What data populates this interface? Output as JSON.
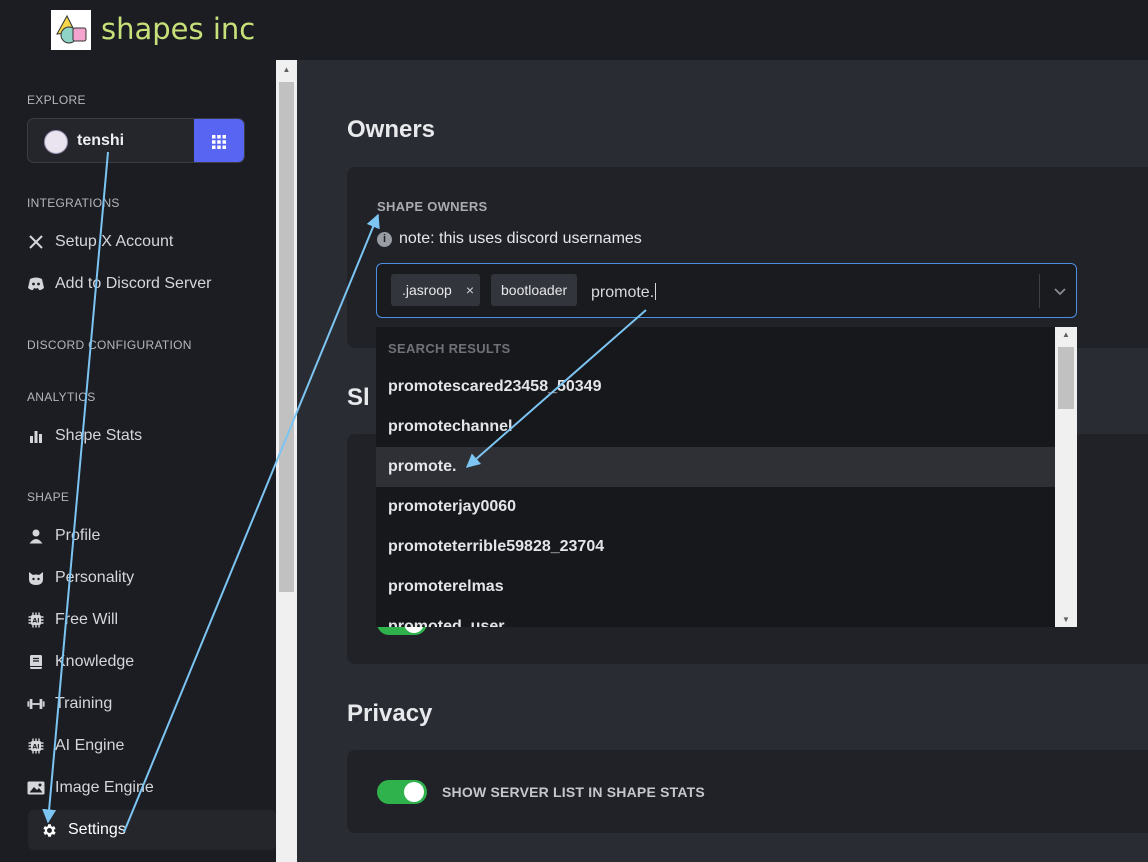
{
  "app": {
    "title": "shapes inc"
  },
  "sidebar": {
    "explore_label": "EXPLORE",
    "shape_selector": {
      "name": "tenshi"
    },
    "integrations_label": "INTEGRATIONS",
    "integrations": [
      {
        "label": "Setup X Account",
        "icon": "x-logo-icon"
      },
      {
        "label": "Add to Discord Server",
        "icon": "discord-icon"
      }
    ],
    "discord_config_label": "DISCORD CONFIGURATION",
    "analytics_label": "ANALYTICS",
    "analytics": [
      {
        "label": "Shape Stats",
        "icon": "bar-chart-icon"
      }
    ],
    "shape_label": "SHAPE",
    "shape_items": [
      {
        "label": "Profile",
        "icon": "user-icon"
      },
      {
        "label": "Personality",
        "icon": "cat-face-icon"
      },
      {
        "label": "Free Will",
        "icon": "chip-icon"
      },
      {
        "label": "Knowledge",
        "icon": "book-icon"
      },
      {
        "label": "Training",
        "icon": "dumbbell-icon"
      },
      {
        "label": "AI Engine",
        "icon": "chip-icon"
      },
      {
        "label": "Image Engine",
        "icon": "image-icon"
      },
      {
        "label": "Settings",
        "icon": "gear-icon",
        "active": true
      }
    ]
  },
  "main": {
    "owners_heading": "Owners",
    "shape_owners_label": "SHAPE OWNERS",
    "note": "note: this uses discord usernames",
    "owner_tags": [
      ".jasroop",
      "bootloader"
    ],
    "owner_tag_remove": "×",
    "search_value": "promote.",
    "dropdown": {
      "header": "SEARCH RESULTS",
      "options": [
        "promotescared23458_50349",
        "promotechannel",
        "promote.",
        "promoterjay0060",
        "promoteterrible59828_23704",
        "promoterelmas",
        "promoted_user"
      ],
      "highlighted_index": 2
    },
    "slash_heading": "Sl",
    "privacy_heading": "Privacy",
    "privacy_toggle": {
      "label": "SHOW SERVER LIST IN SHAPE STATS",
      "on": true
    }
  },
  "colors": {
    "accent": "#5865f2",
    "focus_border": "#4a90e2",
    "toggle_on": "#2fb24c",
    "annotation_arrow": "#7cc4f2"
  }
}
